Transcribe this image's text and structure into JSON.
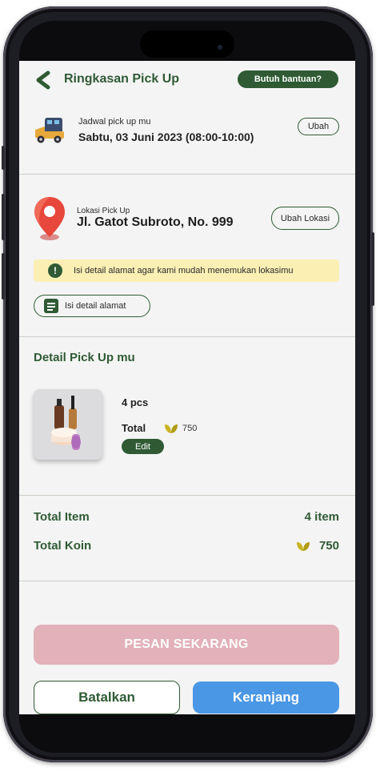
{
  "header": {
    "title": "Ringkasan Pick Up",
    "help_label": "Butuh bantuan?"
  },
  "schedule": {
    "label": "Jadwal pick up mu",
    "value": "Sabtu, 03 Juni 2023 (08:00-10:00)",
    "change_label": "Ubah"
  },
  "location": {
    "label": "Lokasi Pick Up",
    "value": "Jl. Gatot Subroto, No. 999",
    "change_label": "Ubah Lokasi"
  },
  "notice": {
    "icon": "!",
    "text": "Isi detail alamat agar kami mudah menemukan lokasimu"
  },
  "address_button": {
    "label": "Isi detail alamat"
  },
  "detail": {
    "title": "Detail Pick Up mu",
    "quantity": "4 pcs",
    "total_label": "Total",
    "total_value": "750",
    "edit_label": "Edit"
  },
  "summary": {
    "items_label": "Total Item",
    "items_value": "4 item",
    "coins_label": "Total Koin",
    "coins_value": "750"
  },
  "actions": {
    "order_label": "PESAN SEKARANG",
    "cancel_label": "Batalkan",
    "cart_label": "Keranjang"
  },
  "colors": {
    "primary": "#2f5a34",
    "order_disabled": "#e2b1b9",
    "cart": "#4a97e5",
    "notice_bg": "#fbefb4",
    "coin": "#c8b422"
  }
}
